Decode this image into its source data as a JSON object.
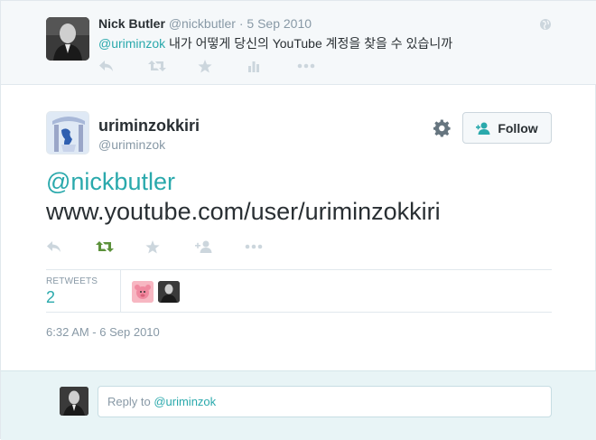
{
  "parent_tweet": {
    "name": "Nick Butler",
    "handle": "@nickbutler",
    "separator": "·",
    "date": "5 Sep 2010",
    "mention": "@uriminzok",
    "text": " 내가 어떻게 당신의 YouTube 계정을 찾을 수 있습니까",
    "icons": [
      "reply-icon",
      "retweet-icon",
      "favorite-icon",
      "stats-icon",
      "more-icon"
    ]
  },
  "main_tweet": {
    "name": "uriminzokkiri",
    "handle": "@uriminzok",
    "follow_label": "Follow",
    "text_mention": "@nickbutler",
    "text_url": "www.youtube.com/user/uriminzokkiri",
    "icons": [
      "reply-icon",
      "retweet-icon",
      "favorite-icon",
      "follow-icon",
      "more-icon"
    ],
    "retweet_active_color": "#5c913b"
  },
  "stats": {
    "label": "RETWEETS",
    "value": "2"
  },
  "timestamp": "6:32 AM - 6 Sep 2010",
  "reply": {
    "prefix": "Reply to ",
    "mention": "@uriminzok"
  },
  "colors": {
    "accent": "#2aa9ac",
    "muted": "#8899a6",
    "text": "#292f33",
    "border": "#e1e8ed",
    "reply_bg": "#e8f4f6"
  }
}
